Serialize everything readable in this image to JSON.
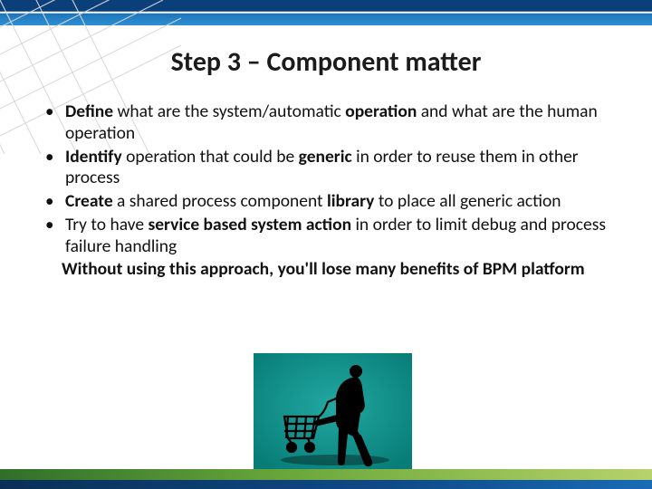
{
  "title": "Step 3 – Component matter",
  "bullets": [
    {
      "pre": "Define",
      "mid1": " what are the system/automatic ",
      "b1": "operation",
      "post": " and what are the human operation"
    },
    {
      "pre": "Identify",
      "mid1": " operation that could be ",
      "b1": "generic",
      "post": " in order to reuse them in other process"
    },
    {
      "pre": "Create",
      "mid1": " a shared process component ",
      "b1": "library",
      "post": " to place all generic action"
    },
    {
      "plain1": "Try to have ",
      "b0": "service based system action",
      "plain2": " in order to limit debug and process failure handling"
    }
  ],
  "closing": "Without using this approach, you'll lose many benefits of BPM platform"
}
